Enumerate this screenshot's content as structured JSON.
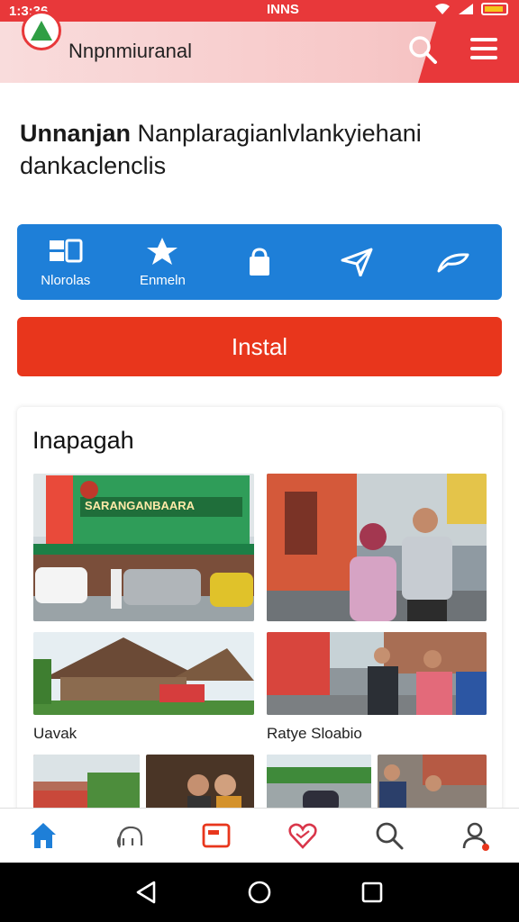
{
  "status_bar": {
    "time": "1:3:36",
    "carrier": "INNS",
    "icons": [
      "wifi-icon",
      "signal-icon",
      "battery-icon"
    ]
  },
  "app_bar": {
    "title": "Nnpnmiuranal",
    "icons": [
      "app-logo",
      "search-icon",
      "menu-icon"
    ]
  },
  "headline": {
    "bold": "Unnanjan",
    "rest": " Nanplaragianlvlankyiehani",
    "line2": "dankaclenclis"
  },
  "features": [
    {
      "label": "Nlorolas",
      "icon": "apps-icon"
    },
    {
      "label": "Enmeln",
      "icon": "star-icon"
    },
    {
      "label": "",
      "icon": "bag-icon"
    },
    {
      "label": "",
      "icon": "send-icon"
    },
    {
      "label": "",
      "icon": "swoosh-icon"
    }
  ],
  "install_button": {
    "label": "Instal"
  },
  "gallery": {
    "title": "Inapagah",
    "banner_text": "SARANGANBAARA",
    "captions": [
      "Uavak",
      "Ratye Sloabio"
    ]
  },
  "bottom_nav": [
    "home-icon",
    "elephant-icon",
    "media-icon",
    "heart-icon",
    "search-icon",
    "profile-icon"
  ],
  "colors": {
    "brand_red": "#e8383a",
    "feature_blue": "#1e7fd8",
    "install_red": "#e8361c",
    "nav_active": "#1e7fd8"
  }
}
